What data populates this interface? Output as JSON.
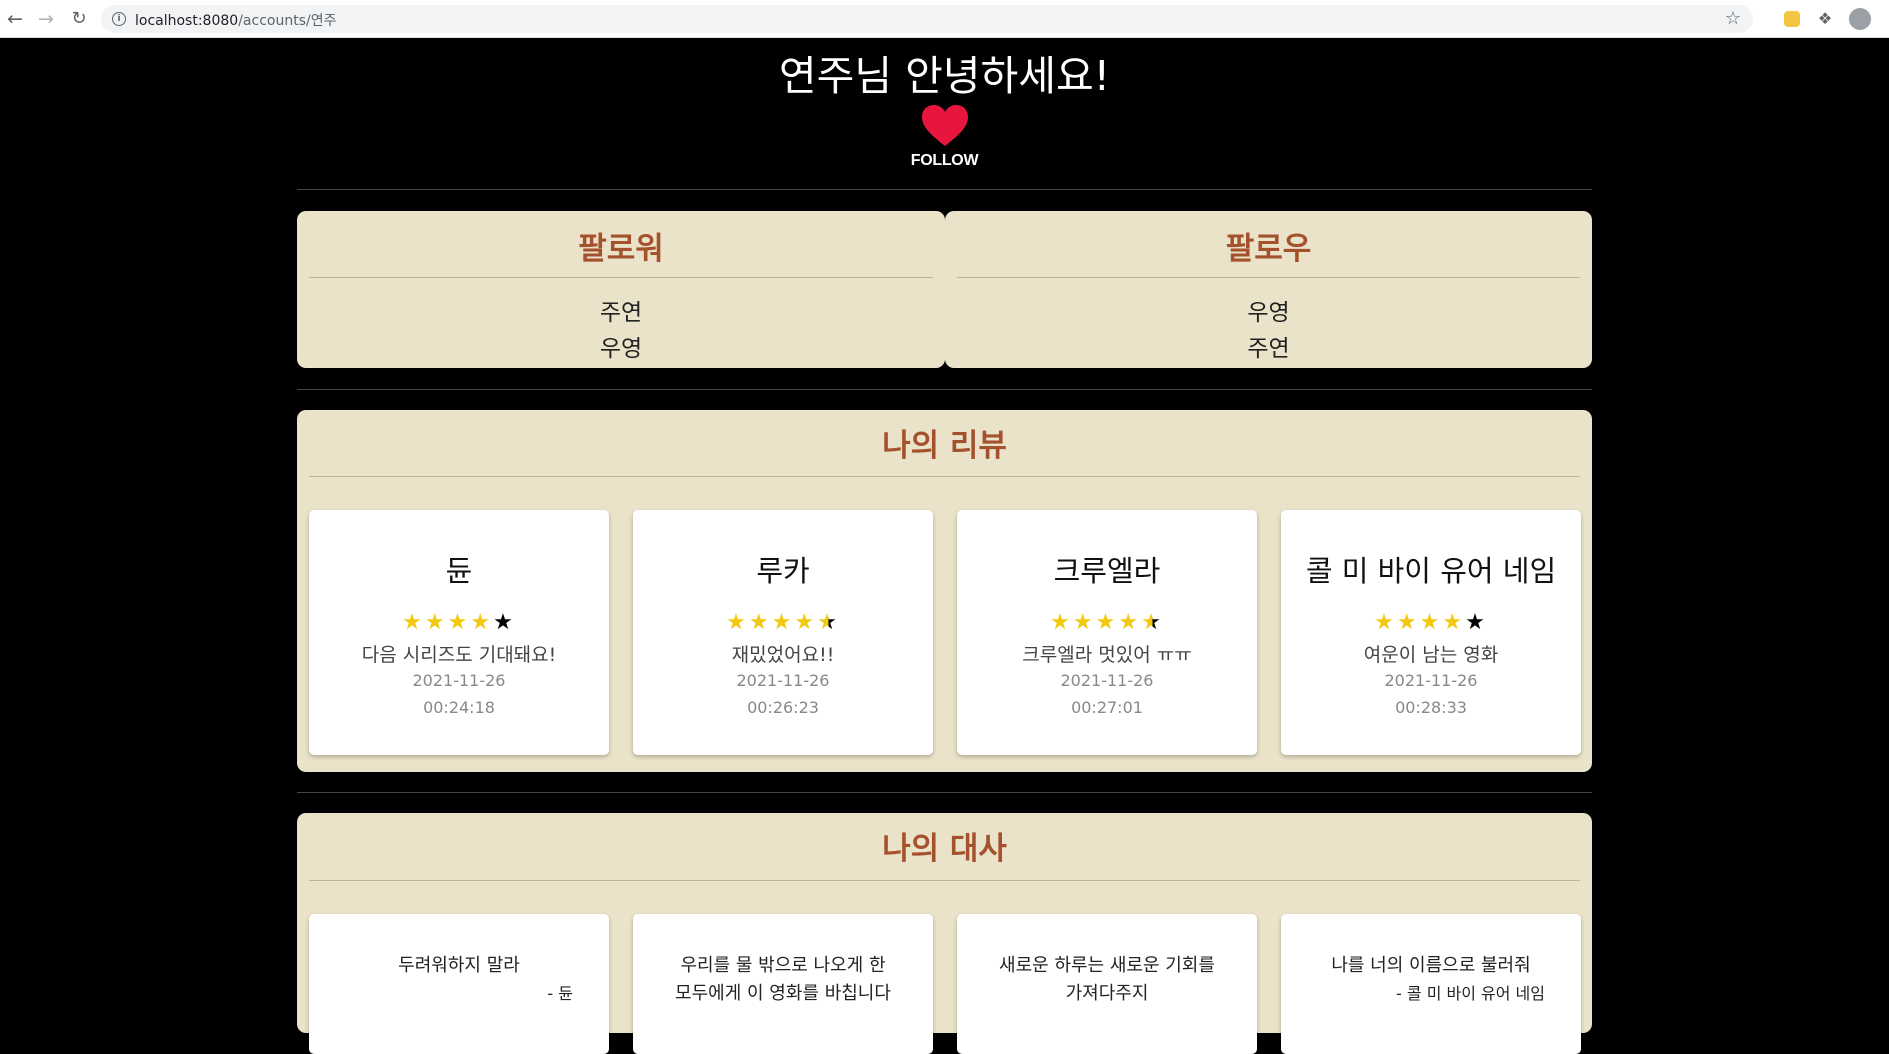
{
  "browser": {
    "url_host": "localhost:8080",
    "url_path": "/accounts/연주"
  },
  "profile": {
    "greeting": "연주님 안녕하세요!",
    "follow_label": "FOLLOW",
    "heart_color": "#e8163f"
  },
  "followers": {
    "title": "팔로워",
    "names": [
      "주연",
      "우영"
    ]
  },
  "following": {
    "title": "팔로우",
    "names": [
      "우영",
      "주연"
    ]
  },
  "reviews": {
    "title": "나의 리뷰",
    "items": [
      {
        "movie": "듄",
        "rating": 4,
        "comment": "다음 시리즈도 기대돼요!",
        "date": "2021-11-26",
        "time": "00:24:18"
      },
      {
        "movie": "루카",
        "rating": 4.5,
        "comment": "재밌었어요!!",
        "date": "2021-11-26",
        "time": "00:26:23"
      },
      {
        "movie": "크루엘라",
        "rating": 4.5,
        "comment": "크루엘라 멋있어 ㅠㅠ",
        "date": "2021-11-26",
        "time": "00:27:01"
      },
      {
        "movie": "콜 미 바이 유어 네임",
        "rating": 4,
        "comment": "여운이 남는 영화",
        "date": "2021-11-26",
        "time": "00:28:33"
      }
    ]
  },
  "quotes": {
    "title": "나의 대사",
    "items": [
      {
        "line1": "두려워하지 말라",
        "line2": "",
        "source": "- 듄"
      },
      {
        "line1": "우리를 물 밖으로 나오게 한",
        "line2": "모두에게 이 영화를 바칩니다",
        "source": ""
      },
      {
        "line1": "새로운 하루는 새로운 기회를",
        "line2": "가져다주지",
        "source": ""
      },
      {
        "line1": "나를 너의 이름으로 불러줘",
        "line2": "",
        "source": "- 콜 미 바이 유어 네임"
      }
    ]
  },
  "colors": {
    "panel_bg": "#ebe3c9",
    "accent": "#a3522d",
    "star": "#f2c811"
  }
}
